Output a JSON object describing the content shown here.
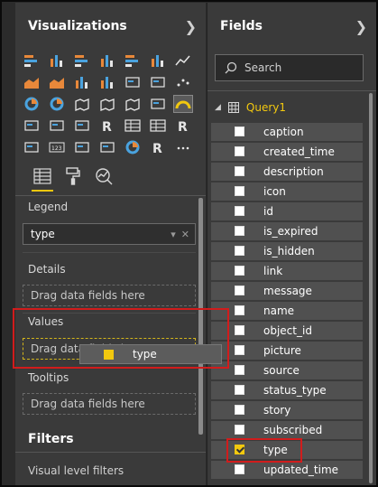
{
  "visualizations": {
    "title": "Visualizations",
    "tabs": [
      "fields-tab",
      "format-tab",
      "analytics-tab"
    ],
    "wells": {
      "legend": {
        "label": "Legend",
        "value": "type"
      },
      "details": {
        "label": "Details",
        "placeholder": "Drag data fields here"
      },
      "values": {
        "label": "Values",
        "placeholder": "Drag data fields here"
      },
      "tooltips": {
        "label": "Tooltips",
        "placeholder": "Drag data fields here"
      }
    },
    "drag_item": "type",
    "filters": {
      "title": "Filters",
      "visual_level": "Visual level filters"
    },
    "icons": [
      "stacked-bar-icon",
      "stacked-column-icon",
      "clustered-bar-icon",
      "clustered-column-icon",
      "100-stacked-bar-icon",
      "100-stacked-column-icon",
      "line-chart-icon",
      "area-chart-icon",
      "stacked-area-icon",
      "line-column-icon",
      "line-clustered-column-icon",
      "ribbon-chart-icon",
      "waterfall-icon",
      "scatter-icon",
      "pie-chart-icon",
      "donut-chart-icon",
      "treemap-icon",
      "map-icon",
      "filled-map-icon",
      "funnel-icon",
      "gauge-icon",
      "multi-row-card-icon",
      "card-icon",
      "kpi-icon",
      "slicer-icon",
      "table-icon",
      "matrix-icon",
      "r-visual-icon",
      "arcgis-icon",
      "text-123-icon",
      "funnel-2-icon",
      "waterfall-2-icon",
      "donut-2-icon",
      "r-script-icon",
      "more-icon"
    ]
  },
  "fields": {
    "title": "Fields",
    "search_placeholder": "Search",
    "table": "Query1",
    "items": [
      {
        "name": "caption",
        "checked": false
      },
      {
        "name": "created_time",
        "checked": false
      },
      {
        "name": "description",
        "checked": false
      },
      {
        "name": "icon",
        "checked": false
      },
      {
        "name": "id",
        "checked": false
      },
      {
        "name": "is_expired",
        "checked": false
      },
      {
        "name": "is_hidden",
        "checked": false
      },
      {
        "name": "link",
        "checked": false
      },
      {
        "name": "message",
        "checked": false
      },
      {
        "name": "name",
        "checked": false
      },
      {
        "name": "object_id",
        "checked": false
      },
      {
        "name": "picture",
        "checked": false
      },
      {
        "name": "source",
        "checked": false
      },
      {
        "name": "status_type",
        "checked": false
      },
      {
        "name": "story",
        "checked": false
      },
      {
        "name": "subscribed",
        "checked": false
      },
      {
        "name": "type",
        "checked": true
      },
      {
        "name": "updated_time",
        "checked": false
      }
    ]
  },
  "colors": {
    "accent": "#f2c80f",
    "highlight": "#d11c1c"
  }
}
